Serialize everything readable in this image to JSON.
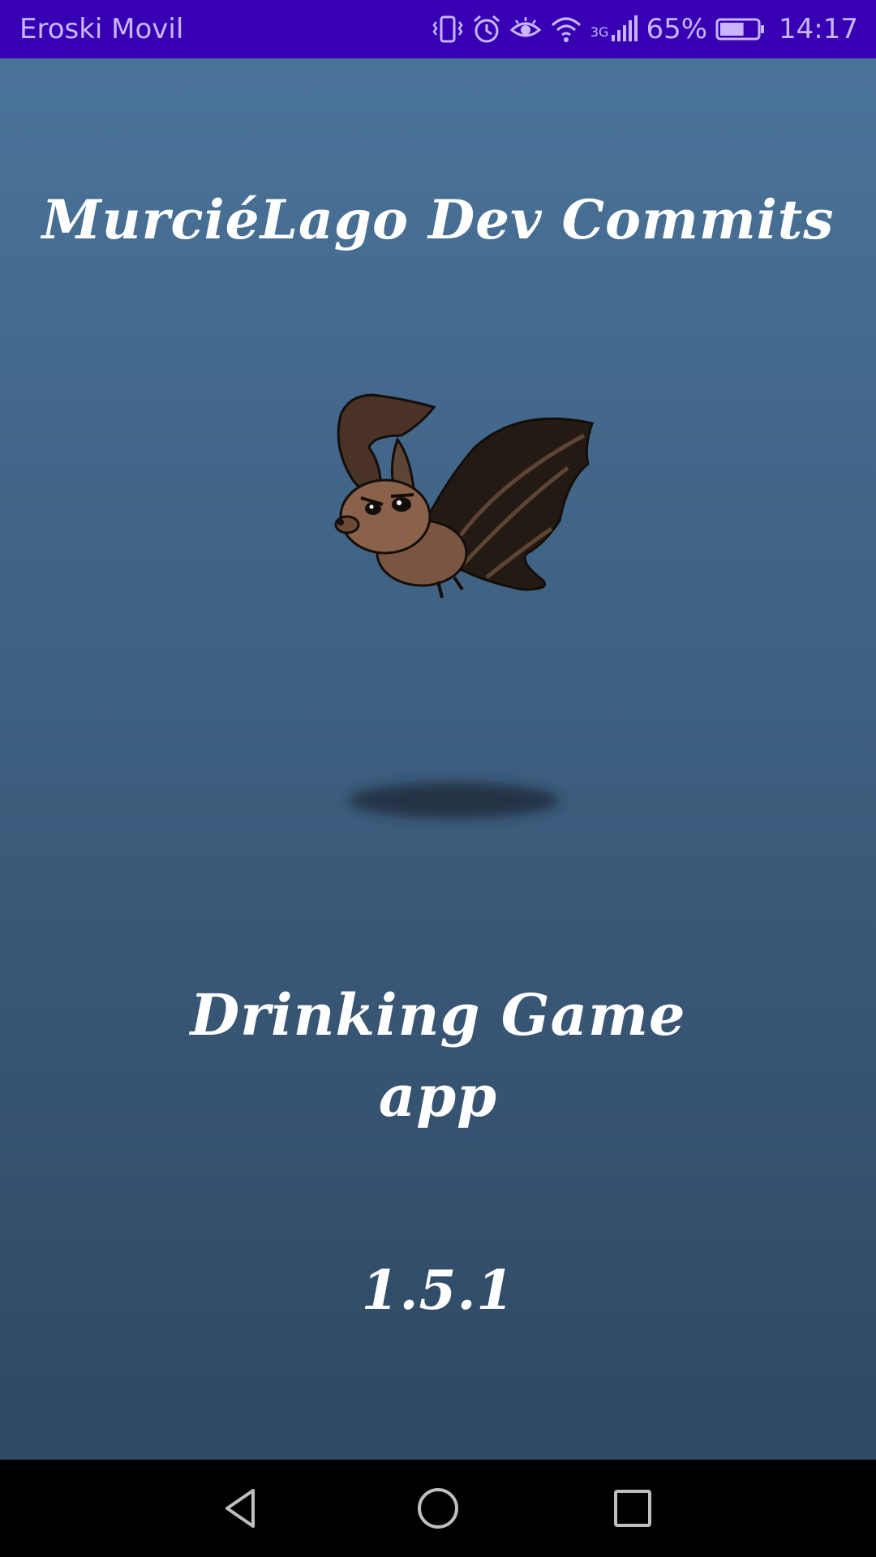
{
  "status_bar": {
    "carrier": "Eroski Movil",
    "network_type": "3G",
    "battery_percent": "65%",
    "battery_level": 0.65,
    "time": "14:17",
    "icons": [
      "vibrate-icon",
      "alarm-icon",
      "eye-comfort-icon",
      "wifi-icon",
      "cell-signal-icon",
      "battery-icon"
    ]
  },
  "splash": {
    "studio_name": "MurciéLago Dev Commits",
    "game_title_line1": "Drinking Game",
    "game_title_line2": "app",
    "version": "1.5.1",
    "logo": "bat-logo",
    "background_top": "#4a7399",
    "background_bottom": "#2f4863"
  },
  "nav_bar": {
    "buttons": [
      "back-icon",
      "home-icon",
      "recents-icon"
    ],
    "color": "#000000"
  }
}
